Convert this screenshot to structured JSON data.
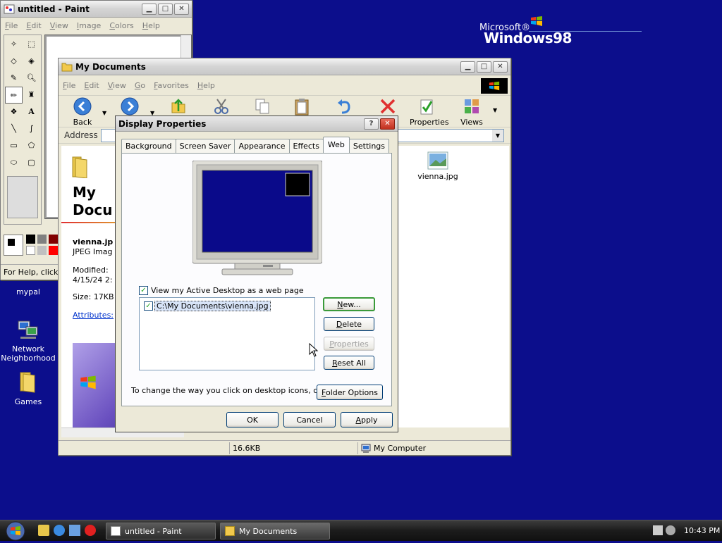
{
  "desktop": {
    "logo": {
      "microsoft": "Microsoft®",
      "windows": "Windows98"
    },
    "icons": [
      {
        "label": "mypal"
      },
      {
        "label": "Network Neighborhood"
      },
      {
        "label": "Games"
      }
    ]
  },
  "paint": {
    "title": "untitled - Paint",
    "menu": [
      "File",
      "Edit",
      "View",
      "Image",
      "Colors",
      "Help"
    ],
    "status": "For Help, click H"
  },
  "mydocs": {
    "title": "My Documents",
    "menu": [
      "File",
      "Edit",
      "View",
      "Go",
      "Favorites",
      "Help"
    ],
    "toolbar": {
      "back": "Back",
      "properties": "Properties",
      "views": "Views"
    },
    "address_label": "Address",
    "panel": {
      "heading_line1": "My",
      "heading_line2": "Docu",
      "file_name": "vienna.jp",
      "file_type": "JPEG Imag",
      "modified_label": "Modified:",
      "modified_value": "4/15/24 2:",
      "size": "Size: 17KB",
      "attributes": "Attributes:"
    },
    "file_icon_label": "vienna.jpg",
    "status": {
      "size": "16.6KB",
      "location": "My Computer"
    }
  },
  "dialog": {
    "title": "Display Properties",
    "help_btn": "?",
    "close_btn": "✕",
    "tabs": [
      "Background",
      "Screen Saver",
      "Appearance",
      "Effects",
      "Web",
      "Settings"
    ],
    "active_tab": "Web",
    "checkbox_label": "View my Active Desktop as a web page",
    "list_items": [
      "C:\\My Documents\\vienna.jpg"
    ],
    "buttons": {
      "new": "New...",
      "delete": "Delete",
      "properties": "Properties",
      "reset_all": "Reset All"
    },
    "hint": "To change the way you click on desktop icons, click:",
    "folder_options": "Folder Options",
    "ok": "OK",
    "cancel": "Cancel",
    "apply": "Apply"
  },
  "taskbar": {
    "tasks": [
      "untitled - Paint",
      "My Documents"
    ],
    "clock": "10:43 PM"
  },
  "colors": {
    "desktop": "#0c0e8c",
    "monitor_screen": "#0a0a8a"
  }
}
